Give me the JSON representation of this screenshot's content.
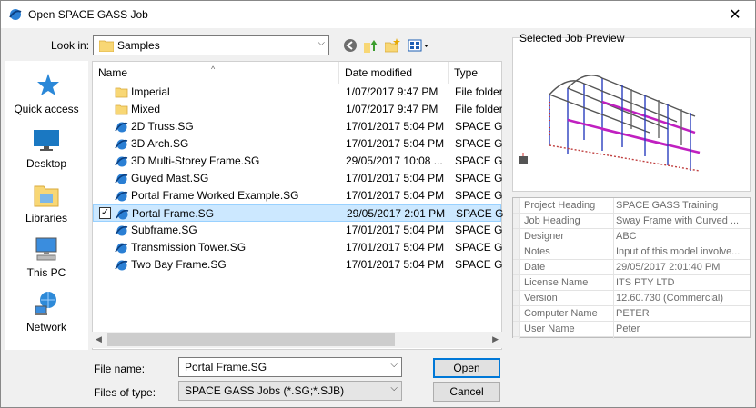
{
  "window": {
    "title": "Open SPACE GASS Job"
  },
  "lookin": {
    "label": "Look in:",
    "value": "Samples"
  },
  "places": [
    {
      "label": "Quick access",
      "icon": "star-icon"
    },
    {
      "label": "Desktop",
      "icon": "desktop-icon"
    },
    {
      "label": "Libraries",
      "icon": "libraries-icon"
    },
    {
      "label": "This PC",
      "icon": "computer-icon"
    },
    {
      "label": "Network",
      "icon": "network-icon"
    }
  ],
  "columns": {
    "name": "Name",
    "date": "Date modified",
    "type": "Type"
  },
  "files": [
    {
      "name": "Imperial",
      "date": "1/07/2017 9:47 PM",
      "type": "File folder",
      "kind": "folder"
    },
    {
      "name": "Mixed",
      "date": "1/07/2017 9:47 PM",
      "type": "File folder",
      "kind": "folder"
    },
    {
      "name": "2D Truss.SG",
      "date": "17/01/2017 5:04 PM",
      "type": "SPACE GASS",
      "kind": "sg"
    },
    {
      "name": "3D Arch.SG",
      "date": "17/01/2017 5:04 PM",
      "type": "SPACE GASS",
      "kind": "sg"
    },
    {
      "name": "3D Multi-Storey Frame.SG",
      "date": "29/05/2017 10:08 ...",
      "type": "SPACE GASS",
      "kind": "sg"
    },
    {
      "name": "Guyed Mast.SG",
      "date": "17/01/2017 5:04 PM",
      "type": "SPACE GASS",
      "kind": "sg"
    },
    {
      "name": "Portal Frame Worked Example.SG",
      "date": "17/01/2017 5:04 PM",
      "type": "SPACE GASS",
      "kind": "sg"
    },
    {
      "name": "Portal Frame.SG",
      "date": "29/05/2017 2:01 PM",
      "type": "SPACE GASS",
      "kind": "sg",
      "selected": true
    },
    {
      "name": "Subframe.SG",
      "date": "17/01/2017 5:04 PM",
      "type": "SPACE GASS",
      "kind": "sg"
    },
    {
      "name": "Transmission Tower.SG",
      "date": "17/01/2017 5:04 PM",
      "type": "SPACE GASS",
      "kind": "sg"
    },
    {
      "name": "Two Bay Frame.SG",
      "date": "17/01/2017 5:04 PM",
      "type": "SPACE GASS",
      "kind": "sg"
    }
  ],
  "filename": {
    "label": "File name:",
    "value": "Portal Frame.SG"
  },
  "filetype": {
    "label": "Files of type:",
    "value": "SPACE GASS Jobs (*.SG;*.SJB)"
  },
  "buttons": {
    "open": "Open",
    "cancel": "Cancel"
  },
  "preview": {
    "label": "Selected Job Preview"
  },
  "properties": [
    {
      "key": "Project Heading",
      "value": "SPACE GASS Training"
    },
    {
      "key": "Job Heading",
      "value": "Sway Frame with Curved ..."
    },
    {
      "key": "Designer",
      "value": "ABC"
    },
    {
      "key": "Notes",
      "value": "Input of this model involve..."
    },
    {
      "key": "Date",
      "value": "29/05/2017 2:01:40 PM"
    },
    {
      "key": "License Name",
      "value": "ITS PTY LTD"
    },
    {
      "key": "Version",
      "value": "12.60.730 (Commercial)"
    },
    {
      "key": "Computer Name",
      "value": "PETER"
    },
    {
      "key": "User Name",
      "value": "Peter"
    }
  ],
  "colors": {
    "selection": "#cce8ff",
    "accent": "#0078d7",
    "folder": "#f8d775"
  }
}
